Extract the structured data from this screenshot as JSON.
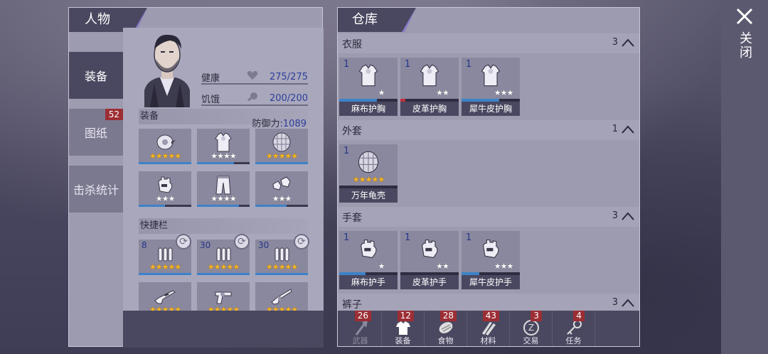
{
  "character": {
    "title": "人物",
    "side_tabs": [
      {
        "label": "装备",
        "active": true,
        "badge": ""
      },
      {
        "label": "图纸",
        "active": false,
        "badge": "52"
      },
      {
        "label": "击杀统计",
        "active": false,
        "badge": ""
      }
    ],
    "stats": {
      "health_label": "健康",
      "health_value": "275/275",
      "hunger_label": "饥饿",
      "hunger_value": "200/200"
    },
    "equipment": {
      "section_label": "装备",
      "defense_label": "防御力",
      "defense_value": ":1089",
      "slots": [
        {
          "icon": "helmet-icon",
          "gold": 5,
          "white": 0,
          "durability": 1.0
        },
        {
          "icon": "vest-icon",
          "gold": 0,
          "white": 4,
          "durability": 0.7
        },
        {
          "icon": "turtle-shell-icon",
          "gold": 5,
          "white": 0,
          "durability": 1.0
        },
        {
          "icon": "glove-icon",
          "gold": 0,
          "white": 3,
          "durability": 0.5
        },
        {
          "icon": "pants-icon",
          "gold": 0,
          "white": 4,
          "durability": 0.8
        },
        {
          "icon": "shoes-icon",
          "gold": 0,
          "white": 3,
          "durability": 0.6
        }
      ]
    },
    "quickbar": {
      "section_label": "快捷栏",
      "slots": [
        {
          "icon": "ammo-icon",
          "count": "8",
          "gold": 5,
          "white": 0,
          "durability": 1.0
        },
        {
          "icon": "ammo-icon",
          "count": "30",
          "gold": 5,
          "white": 0,
          "durability": 1.0
        },
        {
          "icon": "ammo-icon",
          "count": "30",
          "gold": 5,
          "white": 0,
          "durability": 1.0
        },
        {
          "icon": "rifle-icon",
          "count": "",
          "gold": 5,
          "white": 0,
          "durability": 1.0
        },
        {
          "icon": "revolver-icon",
          "count": "",
          "gold": 5,
          "white": 0,
          "durability": 1.0
        },
        {
          "icon": "shotgun-icon",
          "count": "",
          "gold": 5,
          "white": 0,
          "durability": 1.0
        }
      ]
    }
  },
  "warehouse": {
    "title": "仓库",
    "categories": [
      {
        "name": "衣服",
        "count": "3",
        "items": [
          {
            "count": "1",
            "name": "麻布护胸",
            "icon": "vest-icon",
            "white": 1,
            "durability": 0.65,
            "red": false
          },
          {
            "count": "1",
            "name": "皮革护胸",
            "icon": "vest-icon",
            "white": 2,
            "durability": 0.08,
            "red": true
          },
          {
            "count": "1",
            "name": "犀牛皮护胸",
            "icon": "vest-icon",
            "white": 3,
            "durability": 0.65,
            "red": false
          }
        ]
      },
      {
        "name": "外套",
        "count": "1",
        "items": [
          {
            "count": "1",
            "name": "万年龟壳",
            "icon": "turtle-shell-icon",
            "gold": 5,
            "durability": 0.0,
            "red": false
          }
        ]
      },
      {
        "name": "手套",
        "count": "3",
        "items": [
          {
            "count": "1",
            "name": "麻布护手",
            "icon": "glove-icon",
            "white": 1,
            "durability": 0.45,
            "red": false
          },
          {
            "count": "1",
            "name": "皮革护手",
            "icon": "glove-icon",
            "white": 2,
            "durability": 0.0,
            "red": false
          },
          {
            "count": "1",
            "name": "犀牛皮护手",
            "icon": "glove-icon",
            "white": 3,
            "durability": 0.3,
            "red": false
          }
        ]
      },
      {
        "name": "裤子",
        "count": "3",
        "items": []
      }
    ],
    "tabs": [
      {
        "label": "武器",
        "badge": "26",
        "icon": "axe-icon",
        "dim": true
      },
      {
        "label": "装备",
        "badge": "12",
        "icon": "shirt-icon",
        "dim": false
      },
      {
        "label": "食物",
        "badge": "28",
        "icon": "food-icon",
        "dim": false
      },
      {
        "label": "材料",
        "badge": "43",
        "icon": "material-icon",
        "dim": false
      },
      {
        "label": "交易",
        "badge": "3",
        "icon": "trade-icon",
        "dim": false
      },
      {
        "label": "任务",
        "badge": "4",
        "icon": "key-icon",
        "dim": false
      }
    ]
  },
  "close": {
    "label": "关闭"
  },
  "colors": {
    "panel_dark": "#4a4860",
    "panel_light": "#9d9bb0",
    "accent_purple": "#8b7ad0",
    "badge_red": "#9c2e34",
    "durability_blue": "#3c82c8",
    "star_gold": "#f3b623"
  }
}
